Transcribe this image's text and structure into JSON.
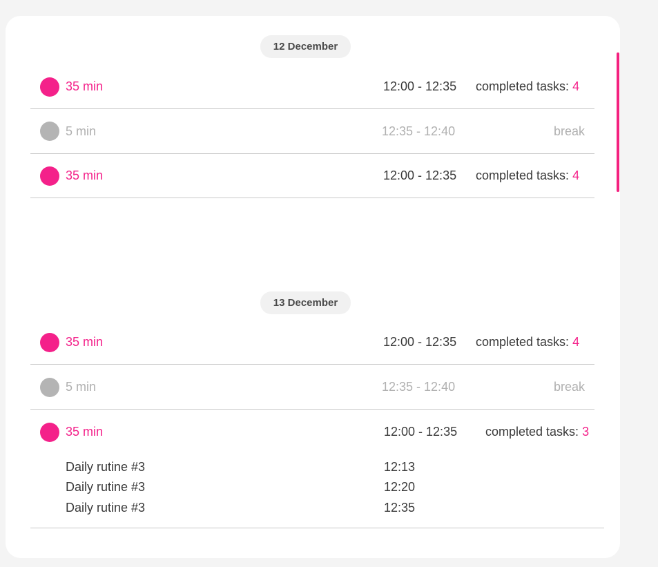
{
  "groups": [
    {
      "date": "12 December",
      "sessions": [
        {
          "duration": "35 min",
          "time": "12:00 - 12:35",
          "label": "completed tasks:",
          "count": "4"
        },
        {
          "duration": "5 min",
          "time": "12:35 - 12:40",
          "label": "break"
        },
        {
          "duration": "35 min",
          "time": "12:00 - 12:35",
          "label": "completed tasks:",
          "count": "4"
        }
      ]
    },
    {
      "date": "13 December",
      "sessions": [
        {
          "duration": "35 min",
          "time": "12:00 - 12:35",
          "label": "completed tasks:",
          "count": "4"
        },
        {
          "duration": "5 min",
          "time": "12:35 - 12:40",
          "label": "break"
        },
        {
          "duration": "35 min",
          "time": "12:00 - 12:35",
          "label": "completed tasks:",
          "count": "3",
          "tasks": [
            {
              "name": "Daily rutine #3",
              "time": "12:13"
            },
            {
              "name": "Daily rutine #3",
              "time": "12:20"
            },
            {
              "name": "Daily rutine #3",
              "time": "12:35"
            }
          ]
        }
      ]
    }
  ],
  "colors": {
    "accent": "#f4218a",
    "break": "#b4b4b4",
    "background": "#f4f4f4",
    "card": "#ffffff"
  }
}
